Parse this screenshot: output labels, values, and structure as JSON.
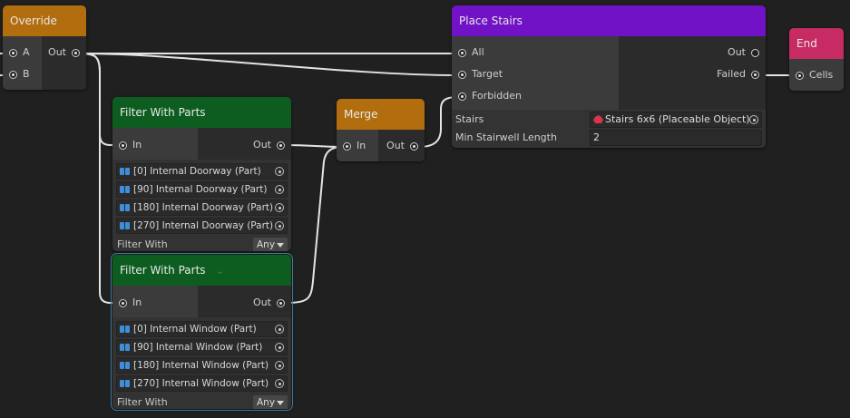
{
  "colors": {
    "orange_header": "#b26d0e",
    "green_header": "#0e5d20",
    "purple_header": "#7112c6",
    "pink_header": "#c72b63",
    "wire": "#e6e6e6",
    "background": "#202020"
  },
  "override": {
    "title": "Override",
    "in_a": "A",
    "in_b": "B",
    "out": "Out"
  },
  "filter1": {
    "title": "Filter With Parts",
    "in": "In",
    "out": "Out",
    "parts": [
      "[0] Internal Doorway (Part)",
      "[90] Internal Doorway (Part)",
      "[180] Internal Doorway (Part)",
      "[270] Internal Doorway (Part)"
    ],
    "filter_label": "Filter With",
    "filter_value": "Any"
  },
  "filter2": {
    "title": "Filter With Parts",
    "chevron": "⌄",
    "in": "In",
    "out": "Out",
    "parts": [
      "[0] Internal Window (Part)",
      "[90] Internal Window (Part)",
      "[180] Internal Window (Part)",
      "[270] Internal Window (Part)"
    ],
    "filter_label": "Filter With",
    "filter_value": "Any"
  },
  "merge": {
    "title": "Merge",
    "in": "In",
    "out": "Out"
  },
  "place_stairs": {
    "title": "Place Stairs",
    "in_all": "All",
    "in_target": "Target",
    "in_forbidden": "Forbidden",
    "out": "Out",
    "out_failed": "Failed",
    "stairs_label": "Stairs",
    "stairs_value": "Stairs 6x6 (Placeable Object)",
    "min_stairwell_label": "Min Stairwell Length",
    "min_stairwell_value": "2"
  },
  "end": {
    "title": "End",
    "in": "Cells"
  }
}
